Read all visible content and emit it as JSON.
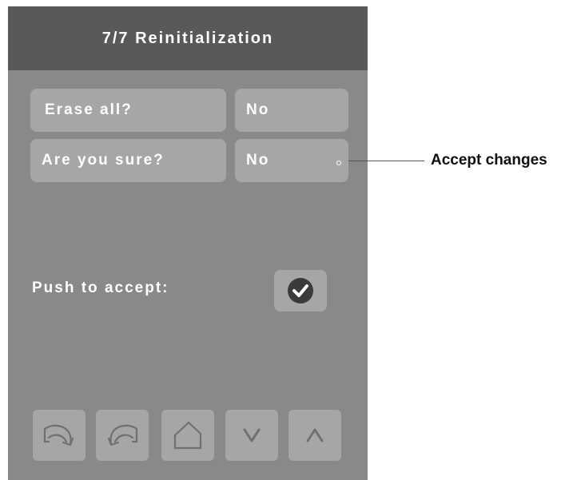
{
  "header": {
    "title": "7/7 Reinitialization"
  },
  "settings": [
    {
      "label": "Erase all?",
      "value": "No"
    },
    {
      "label": "Are you sure?",
      "value": "No"
    }
  ],
  "accept": {
    "label": "Push to accept:",
    "icon": "checkmark-icon"
  },
  "nav": {
    "buttons": [
      "undo-icon",
      "redo-icon",
      "home-icon",
      "chevron-down-icon",
      "chevron-up-icon"
    ]
  },
  "callout": {
    "text": "Accept changes"
  },
  "colors": {
    "panel": "#898989",
    "header": "#595959",
    "button": "#a6a6a6",
    "text": "#ffffff"
  }
}
